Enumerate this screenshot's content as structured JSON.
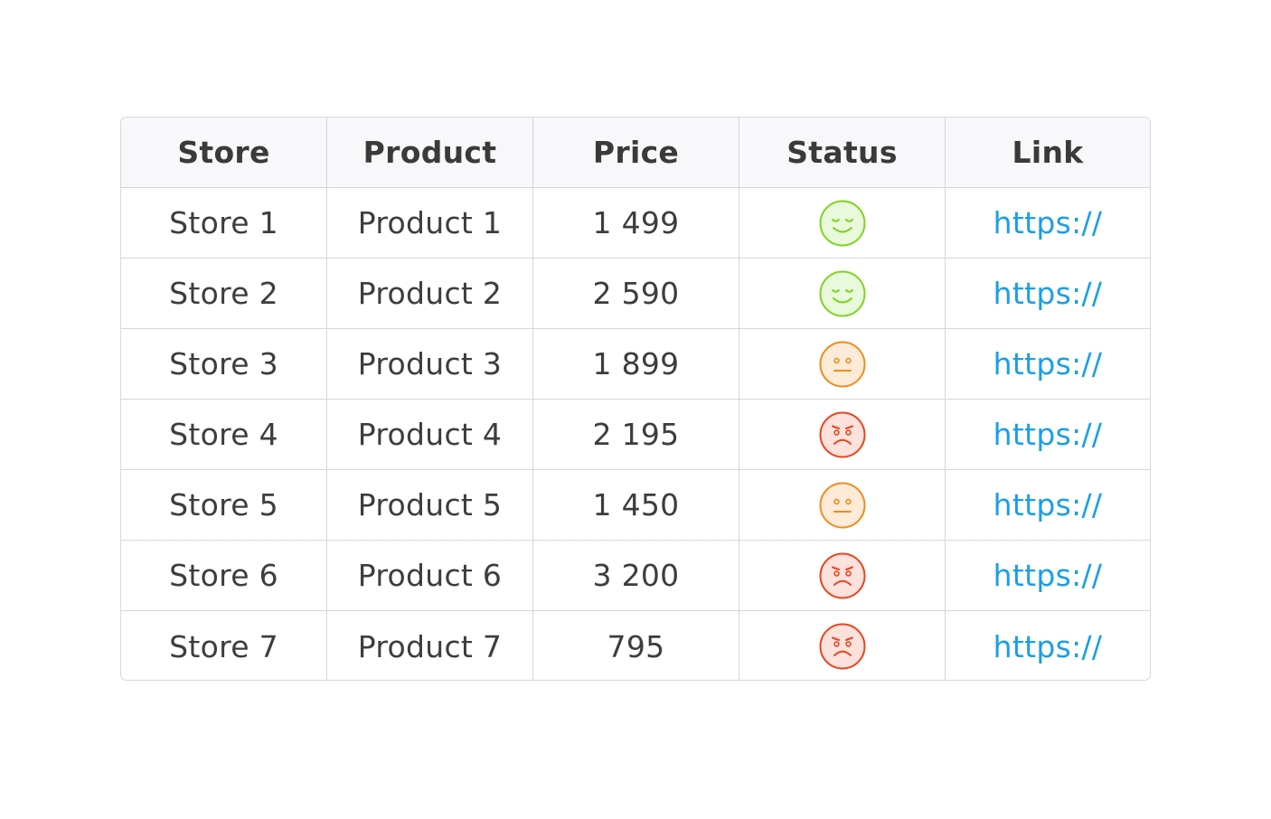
{
  "table": {
    "headers": [
      "Store",
      "Product",
      "Price",
      "Status",
      "Link"
    ],
    "rows": [
      {
        "store": "Store 1",
        "product": "Product 1",
        "price": "1 499",
        "status": "happy",
        "link": "https://"
      },
      {
        "store": "Store 2",
        "product": "Product 2",
        "price": "2 590",
        "status": "happy",
        "link": "https://"
      },
      {
        "store": "Store 3",
        "product": "Product 3",
        "price": "1 899",
        "status": "neutral",
        "link": "https://"
      },
      {
        "store": "Store 4",
        "product": "Product 4",
        "price": "2 195",
        "status": "angry",
        "link": "https://"
      },
      {
        "store": "Store 5",
        "product": "Product 5",
        "price": "1 450",
        "status": "neutral",
        "link": "https://"
      },
      {
        "store": "Store 6",
        "product": "Product 6",
        "price": "3 200",
        "status": "angry",
        "link": "https://"
      },
      {
        "store": "Store 7",
        "product": "Product 7",
        "price": "795",
        "status": "angry",
        "link": "https://"
      }
    ]
  },
  "status_icons": {
    "happy": {
      "icon": "happy-face-icon",
      "stroke": "#7ed321",
      "fill": "#e9f9dc"
    },
    "neutral": {
      "icon": "neutral-face-icon",
      "stroke": "#f08c1a",
      "fill": "#fdebd8"
    },
    "angry": {
      "icon": "angry-face-icon",
      "stroke": "#e8451e",
      "fill": "#fde1dc"
    }
  },
  "colors": {
    "link": "#1a9ee8",
    "header_bg": "#f8f8fa",
    "border": "#d6d7db",
    "text": "#3d3d3d"
  }
}
